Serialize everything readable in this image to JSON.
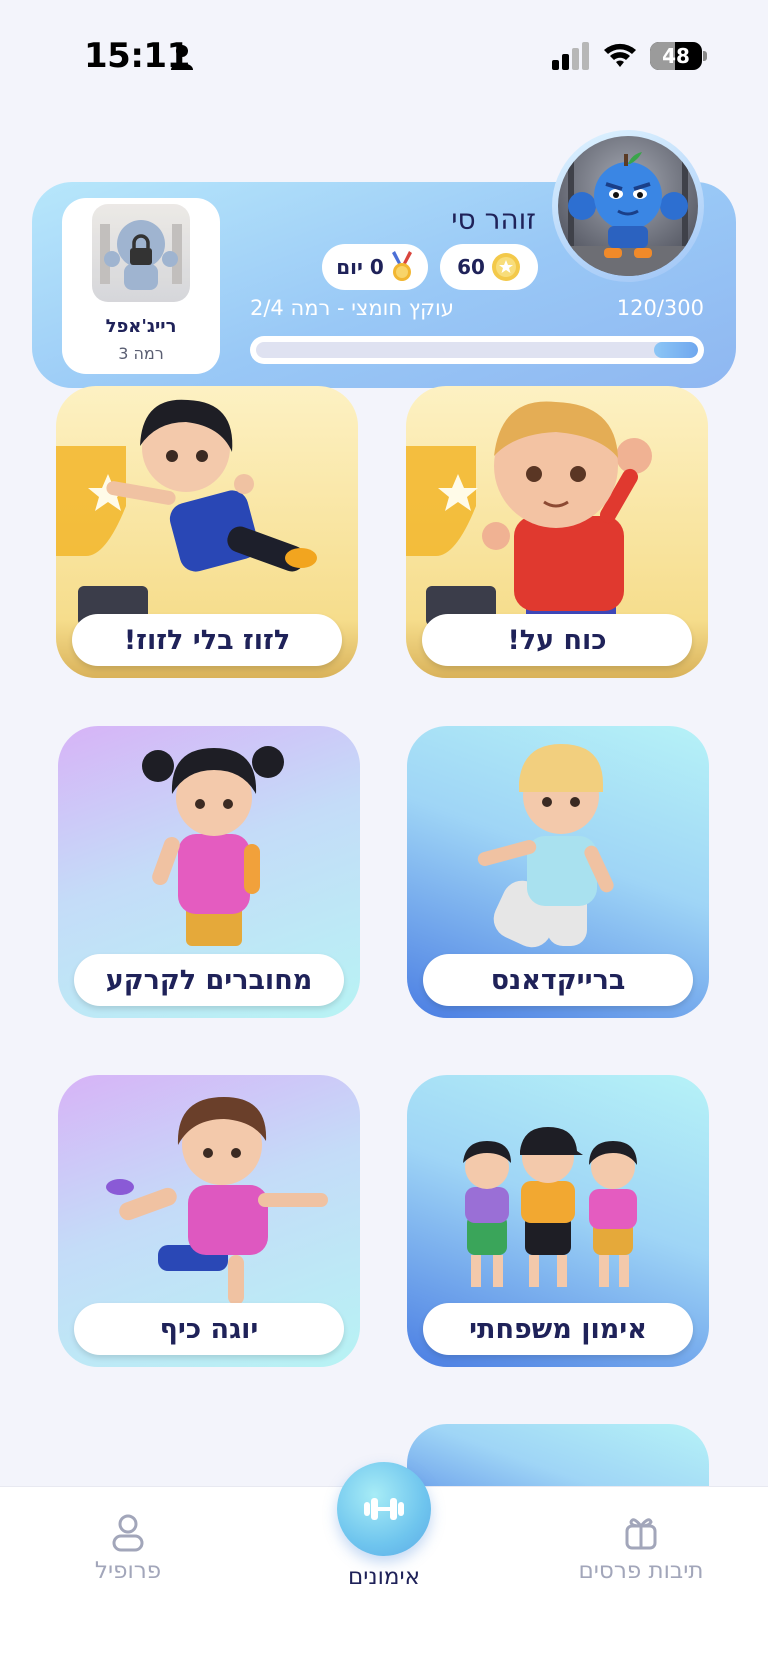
{
  "status_bar": {
    "time": "15:11",
    "battery": "48",
    "battery_level_percent": 48
  },
  "profile": {
    "username": "זוהר סי",
    "coins": "60",
    "streak": "0 יום",
    "level_text": "עוקץ חומצי  - רמה 2/4",
    "xp": "120/300",
    "xp_progress_fraction": 0.1,
    "next_character": {
      "name": "רייג'אפל",
      "level": "רמה 3",
      "locked": true
    }
  },
  "workouts": [
    {
      "label": "כוח על!",
      "theme": "yellow"
    },
    {
      "label": "לזוז בלי לזוז!",
      "theme": "yellow"
    },
    {
      "label": "ברייקדאנס",
      "theme": "blue"
    },
    {
      "label": "מחוברים לקרקע",
      "theme": "purple"
    },
    {
      "label": "אימון משפחתי",
      "theme": "blue"
    },
    {
      "label": "יוגה כיף",
      "theme": "purple"
    }
  ],
  "bottom_nav": {
    "rewards": "תיבות פרסים",
    "workouts": "אימונים",
    "profile": "פרופיל"
  },
  "colors": {
    "primary_text": "#1f2259",
    "inactive_nav": "#a2a6ba",
    "card_gradient_start": "#b7e7fb",
    "card_gradient_end": "#8fb7f1"
  }
}
